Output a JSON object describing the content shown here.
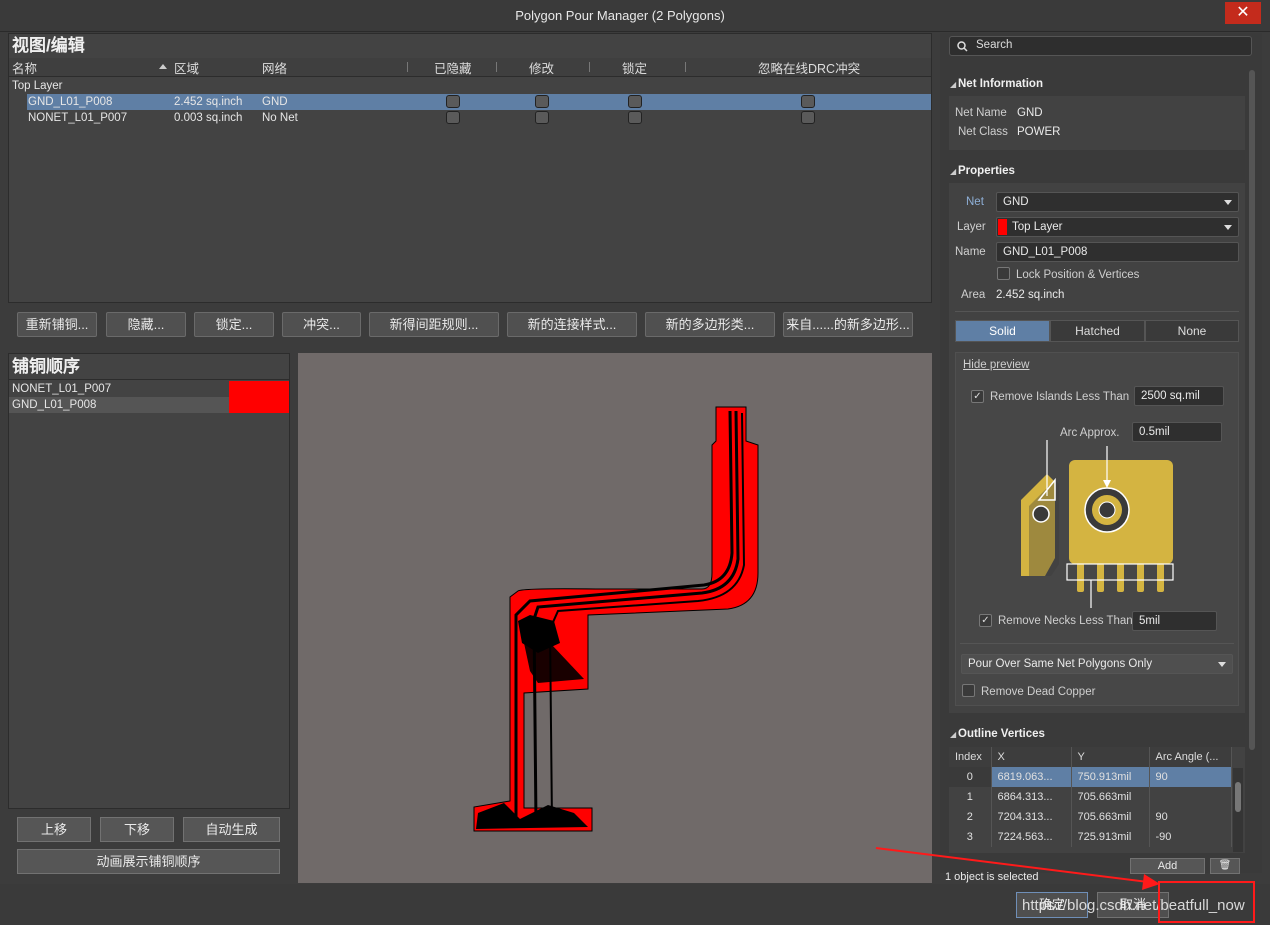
{
  "window": {
    "title": "Polygon Pour Manager (2 Polygons)",
    "close": "✕"
  },
  "view_edit": {
    "title": "视图/编辑",
    "columns": [
      "名称",
      "区域",
      "网络",
      "已隐藏",
      "修改",
      "锁定",
      "忽略在线DRC冲突"
    ],
    "group": "Top Layer",
    "rows": [
      {
        "name": "GND_L01_P008",
        "area": "2.452 sq.inch",
        "net": "GND"
      },
      {
        "name": "NONET_L01_P007",
        "area": "0.003 sq.inch",
        "net": "No Net"
      }
    ]
  },
  "toolbar": {
    "buttons": [
      "重新铺铜...",
      "隐藏...",
      "锁定...",
      "冲突...",
      "新得间距规则...",
      "新的连接样式...",
      "新的多边形类...",
      "来自......的新多边形..."
    ]
  },
  "pour_order": {
    "title": "铺铜顺序",
    "items": [
      "NONET_L01_P007",
      "GND_L01_P008"
    ],
    "buttons": [
      "上移",
      "下移",
      "自动生成"
    ],
    "animate": "动画展示铺铜顺序"
  },
  "search": {
    "placeholder": "Search",
    "icon": "search-icon"
  },
  "net_info": {
    "title": "Net Information",
    "net_name_label": "Net Name",
    "net_name": "GND",
    "net_class_label": "Net Class",
    "net_class": "POWER"
  },
  "properties": {
    "title": "Properties",
    "net_label": "Net",
    "net": "GND",
    "layer_label": "Layer",
    "layer": "Top Layer",
    "layer_color": "#ff0000",
    "name_label": "Name",
    "name": "GND_L01_P008",
    "lock_label": "Lock Position & Vertices",
    "area_label": "Area",
    "area": "2.452 sq.inch",
    "fill_modes": [
      "Solid",
      "Hatched",
      "None"
    ],
    "hide_preview": "Hide preview",
    "remove_islands_label": "Remove Islands Less Than",
    "remove_islands": "2500 sq.mil",
    "arc_approx_label": "Arc Approx.",
    "arc_approx": "0.5mil",
    "remove_necks_label": "Remove Necks Less Than",
    "remove_necks": "5mil",
    "pour_over": "Pour Over Same Net Polygons Only",
    "remove_dead_label": "Remove Dead Copper"
  },
  "outline": {
    "title": "Outline Vertices",
    "columns": [
      "Index",
      "X",
      "Y",
      "Arc Angle (..."
    ],
    "rows": [
      [
        "0",
        "6819.063...",
        "750.913mil",
        "90"
      ],
      [
        "1",
        "6864.313...",
        "705.663mil",
        ""
      ],
      [
        "2",
        "7204.313...",
        "705.663mil",
        "90"
      ],
      [
        "3",
        "7224.563...",
        "725.913mil",
        "-90"
      ]
    ],
    "add": "Add"
  },
  "status": "1 object is selected",
  "footer": {
    "ok": "确定",
    "cancel": "取消",
    "watermark": "https://blog.csdn.net/beatfull_now"
  },
  "colors": {
    "accent": "#5f7fa5",
    "copper": "#ff0000",
    "preview_gold": "#d4b441"
  }
}
